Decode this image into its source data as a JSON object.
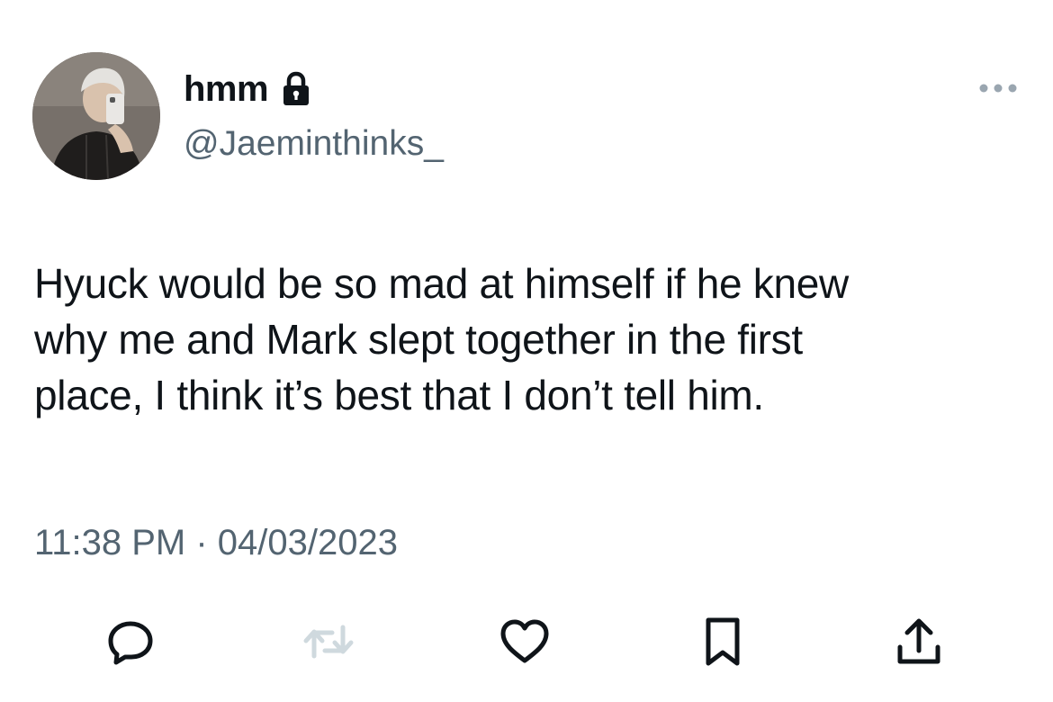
{
  "tweet": {
    "display_name": "hmm",
    "handle": "@Jaeminthinks_",
    "text": "Hyuck would be so mad at himself if he knew\nwhy me and Mark slept together in the first\nplace, I think it’s best that I don’t tell him.",
    "time": "11:38 PM",
    "separator": " · ",
    "date": "04/03/2023"
  },
  "icons": {
    "avatar": "profile-photo",
    "lock": "lock-icon",
    "more": "more-icon",
    "reply": "reply-icon",
    "retweet": "retweet-icon",
    "like": "heart-icon",
    "bookmark": "bookmark-icon",
    "share": "share-icon"
  },
  "colors": {
    "text_primary": "#0f1419",
    "text_secondary": "#536471",
    "icon_dark": "#0f1419",
    "icon_disabled": "#cfd9de",
    "background": "#ffffff"
  }
}
